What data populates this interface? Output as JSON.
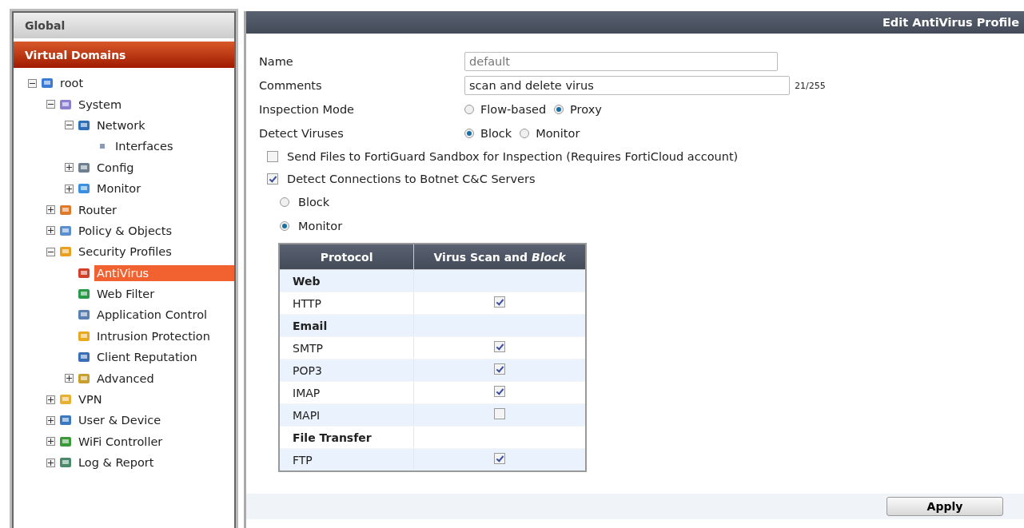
{
  "sidebar": {
    "tabs": [
      {
        "label": "Global",
        "selected": false
      },
      {
        "label": "Virtual Domains",
        "selected": true
      }
    ],
    "tree": [
      {
        "label": "root",
        "expanded": true,
        "selected": false,
        "children": [
          {
            "label": "System",
            "expanded": true,
            "selected": false,
            "children": [
              {
                "label": "Network",
                "expanded": true,
                "selected": false,
                "children": [
                  {
                    "label": "Interfaces",
                    "selected": false
                  }
                ]
              },
              {
                "label": "Config",
                "expanded": false,
                "selected": false
              },
              {
                "label": "Monitor",
                "expanded": false,
                "selected": false
              }
            ]
          },
          {
            "label": "Router",
            "expanded": false,
            "selected": false
          },
          {
            "label": "Policy & Objects",
            "expanded": false,
            "selected": false
          },
          {
            "label": "Security Profiles",
            "expanded": true,
            "selected": false,
            "children": [
              {
                "label": "AntiVirus",
                "selected": true
              },
              {
                "label": "Web Filter",
                "selected": false
              },
              {
                "label": "Application Control",
                "selected": false
              },
              {
                "label": "Intrusion Protection",
                "selected": false
              },
              {
                "label": "Client Reputation",
                "selected": false
              },
              {
                "label": "Advanced",
                "expanded": false,
                "selected": false
              }
            ]
          },
          {
            "label": "VPN",
            "expanded": false,
            "selected": false
          },
          {
            "label": "User & Device",
            "expanded": false,
            "selected": false
          },
          {
            "label": "WiFi Controller",
            "expanded": false,
            "selected": false
          },
          {
            "label": "Log & Report",
            "expanded": false,
            "selected": false
          }
        ]
      }
    ]
  },
  "panel": {
    "title": "Edit AntiVirus Profile",
    "fields": [
      {
        "kind": "text",
        "label": "Name",
        "value": "default"
      },
      {
        "kind": "textarea",
        "label": "Comments",
        "value": "scan and delete virus",
        "counter": "21/255"
      },
      {
        "kind": "radio",
        "label": "Inspection Mode",
        "options": [
          {
            "label": "Flow-based",
            "selected": false
          },
          {
            "label": "Proxy",
            "selected": true
          }
        ]
      },
      {
        "kind": "radio",
        "label": "Detect Viruses",
        "options": [
          {
            "label": "Block",
            "selected": true
          },
          {
            "label": "Monitor",
            "selected": false
          }
        ]
      }
    ],
    "checkboxes": [
      {
        "label": "Send Files to FortiGuard Sandbox for Inspection (Requires FortiCloud account)",
        "checked": false
      },
      {
        "label": "Detect Connections to Botnet C&C Servers",
        "checked": true
      }
    ],
    "botnet_options": [
      {
        "label": "Block",
        "selected": false
      },
      {
        "label": "Monitor",
        "selected": true
      }
    ],
    "table": {
      "columns": [
        "Protocol",
        "Virus Scan and *Block*"
      ],
      "rows": [
        {
          "kind": "group",
          "label": "Web"
        },
        {
          "kind": "protocol",
          "label": "HTTP",
          "checked": true
        },
        {
          "kind": "group",
          "label": "Email"
        },
        {
          "kind": "protocol",
          "label": "SMTP",
          "checked": true
        },
        {
          "kind": "protocol",
          "label": "POP3",
          "checked": true
        },
        {
          "kind": "protocol",
          "label": "IMAP",
          "checked": true
        },
        {
          "kind": "protocol",
          "label": "MAPI",
          "checked": false
        },
        {
          "kind": "group",
          "label": "File Transfer"
        },
        {
          "kind": "protocol",
          "label": "FTP",
          "checked": true
        }
      ]
    },
    "apply_button": "Apply"
  }
}
